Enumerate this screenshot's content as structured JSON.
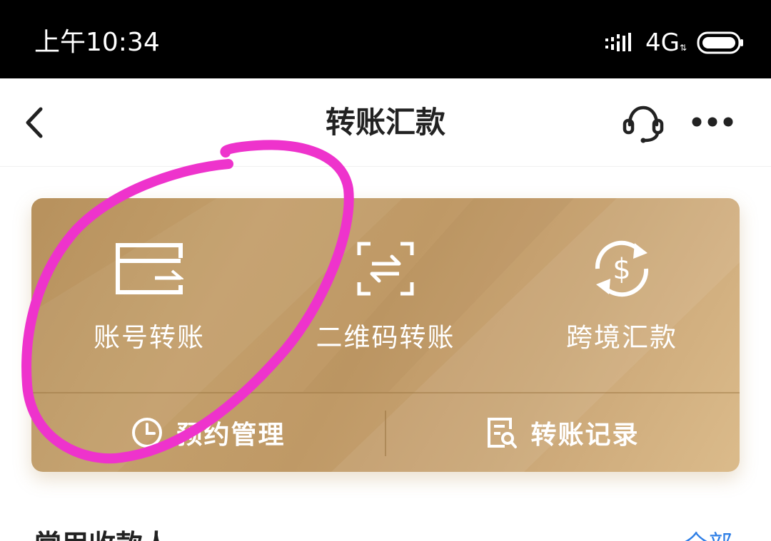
{
  "status_bar": {
    "time": "上午10:34",
    "network": "4G",
    "data_arrows": "⇅"
  },
  "nav": {
    "title": "转账汇款",
    "icons": {
      "back": "chevron-left-icon",
      "service": "headset-icon",
      "more": "more-dots-icon"
    }
  },
  "card": {
    "features": [
      {
        "label": "账号转账",
        "icon": "card-transfer-icon"
      },
      {
        "label": "二维码转账",
        "icon": "qr-scan-transfer-icon"
      },
      {
        "label": "跨境汇款",
        "icon": "dollar-exchange-icon"
      }
    ],
    "bottom_actions": [
      {
        "label": "预约管理",
        "icon": "clock-icon"
      },
      {
        "label": "转账记录",
        "icon": "record-search-icon"
      }
    ],
    "colors": {
      "gold_start": "#b7915d",
      "gold_end": "#dbbb8b"
    }
  },
  "section": {
    "title": "常用收款人",
    "link": "全部"
  },
  "annotation": {
    "color": "#ee33cc",
    "target": "账号转账"
  }
}
